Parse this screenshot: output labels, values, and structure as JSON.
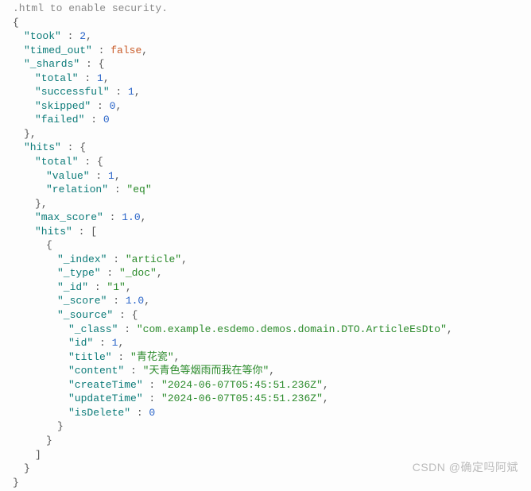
{
  "topComment": ".html to enable security.",
  "json": {
    "took": 2,
    "timed_out": "false",
    "_shards": {
      "total": 1,
      "successful": 1,
      "skipped": 0,
      "failed": 0
    },
    "hits": {
      "total": {
        "value": 1,
        "relation": "eq"
      },
      "max_score": "1.0",
      "hits_arr": {
        "_index": "article",
        "_type": "_doc",
        "_id": "1",
        "_score": "1.0",
        "_source": {
          "_class": "com.example.esdemo.demos.domain.DTO.ArticleEsDto",
          "id": 1,
          "title": "青花瓷",
          "content": "天青色等烟雨而我在等你",
          "createTime": "2024-06-07T05:45:51.236Z",
          "updateTime": "2024-06-07T05:45:51.236Z",
          "isDelete": 0
        }
      }
    }
  },
  "watermark": "CSDN @确定吗阿斌"
}
